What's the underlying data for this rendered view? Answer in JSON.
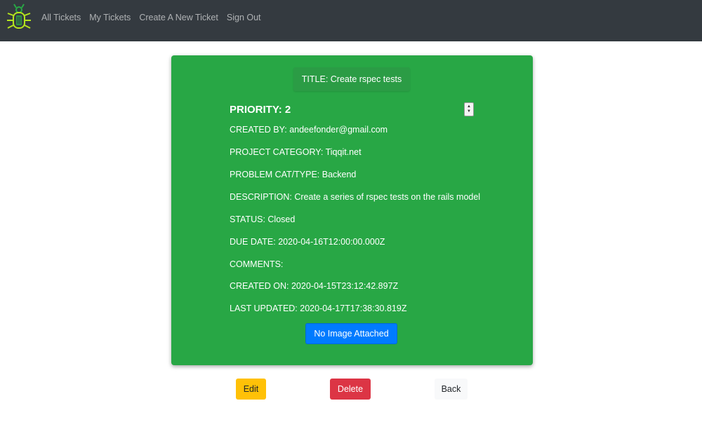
{
  "navbar": {
    "links": [
      "All Tickets",
      "My Tickets",
      "Create A New Ticket",
      "Sign Out"
    ],
    "bg_color": "#343a40",
    "logo_icon": "bug-icon"
  },
  "ticket": {
    "card_color": "#28a745",
    "title": "TITLE: Create rspec tests",
    "priority": "PRIORITY: 2",
    "created_by": "CREATED BY: andeefonder@gmail.com",
    "project_category": "PROJECT CATEGORY: Tiqqit.net",
    "problem_type": "PROBLEM CAT/TYPE: Backend",
    "description": "DESCRIPTION: Create a series of rspec tests on the rails model",
    "status": "STATUS: Closed",
    "due_date": "DUE DATE: 2020-04-16T12:00:00.000Z",
    "comments": "COMMENTS:",
    "created_on": "CREATED ON: 2020-04-15T23:12:42.897Z",
    "last_updated": "LAST UPDATED: 2020-04-17T17:38:30.819Z",
    "image_button": "No Image Attached"
  },
  "actions": {
    "edit": "Edit",
    "delete": "Delete",
    "back": "Back"
  }
}
